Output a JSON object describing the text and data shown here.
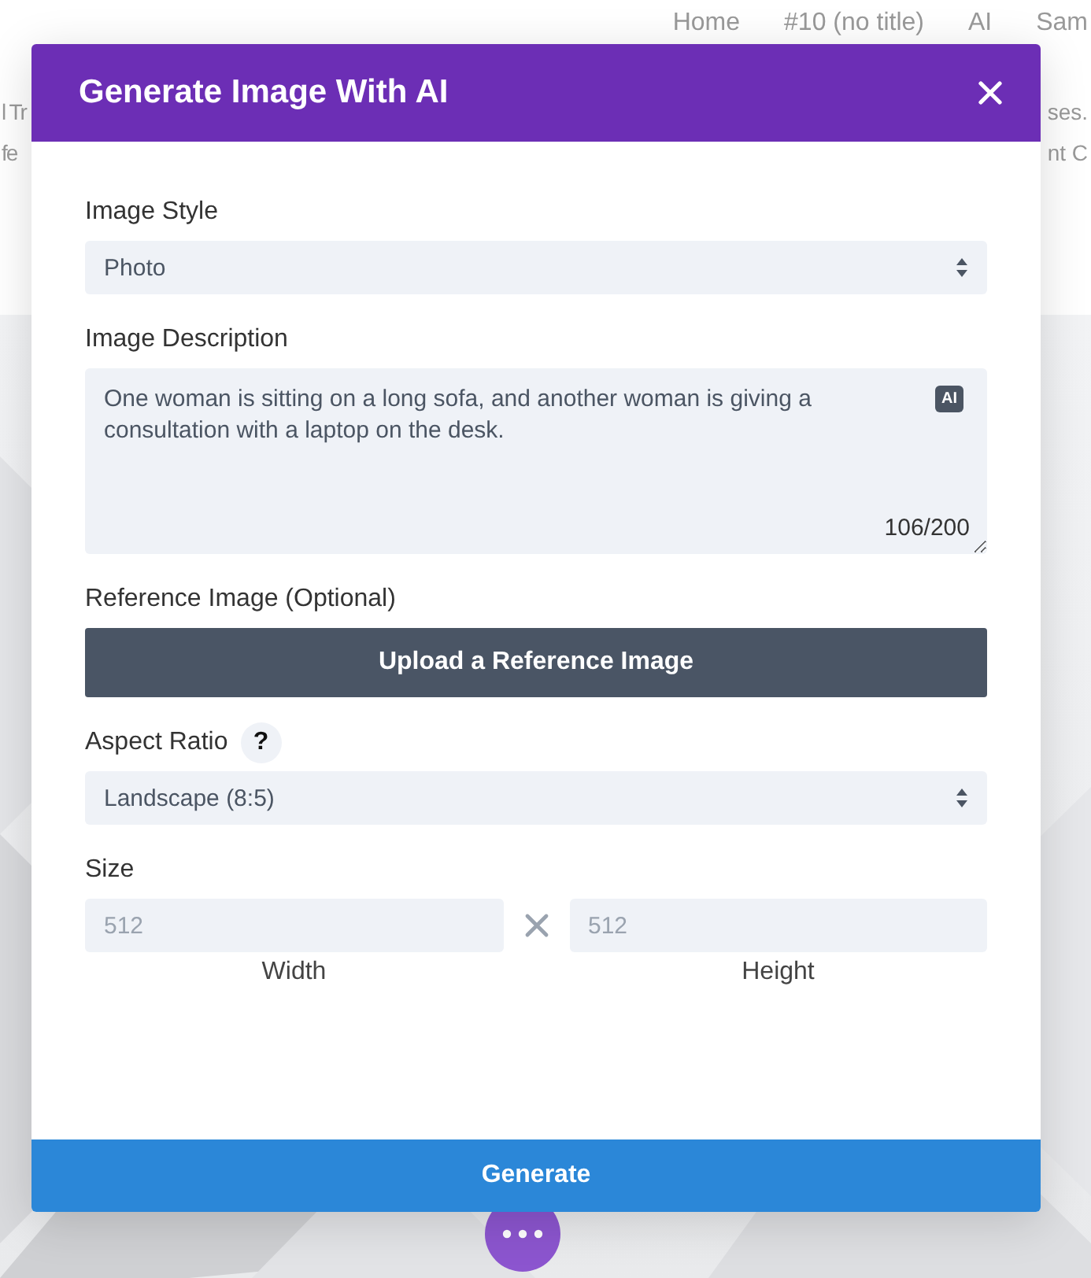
{
  "background_page": {
    "nav": [
      "Home",
      "#10 (no title)",
      "AI",
      "Sam"
    ],
    "text_lines": [
      {
        "left": "l Tr",
        "right": "ses."
      },
      {
        "left": "fe",
        "right": "nt C"
      }
    ]
  },
  "dialog": {
    "title": "Generate Image With AI",
    "fields": [
      {
        "kind": "select",
        "label": "Image Style",
        "value": "Photo"
      },
      {
        "kind": "textarea",
        "label": "Image Description",
        "value": "One woman is sitting on a long sofa, and another woman is giving a consultation with a laptop on the desk.",
        "counter": "106/200",
        "badge": "AI"
      },
      {
        "kind": "upload",
        "label": "Reference Image (Optional)",
        "button": "Upload a Reference Image"
      },
      {
        "kind": "select",
        "label": "Aspect Ratio",
        "help": "?",
        "value": "Landscape (8:5)"
      },
      {
        "kind": "size",
        "label": "Size",
        "width": {
          "placeholder": "512",
          "caption": "Width"
        },
        "height": {
          "placeholder": "512",
          "caption": "Height"
        }
      }
    ],
    "primary_button": "Generate"
  }
}
